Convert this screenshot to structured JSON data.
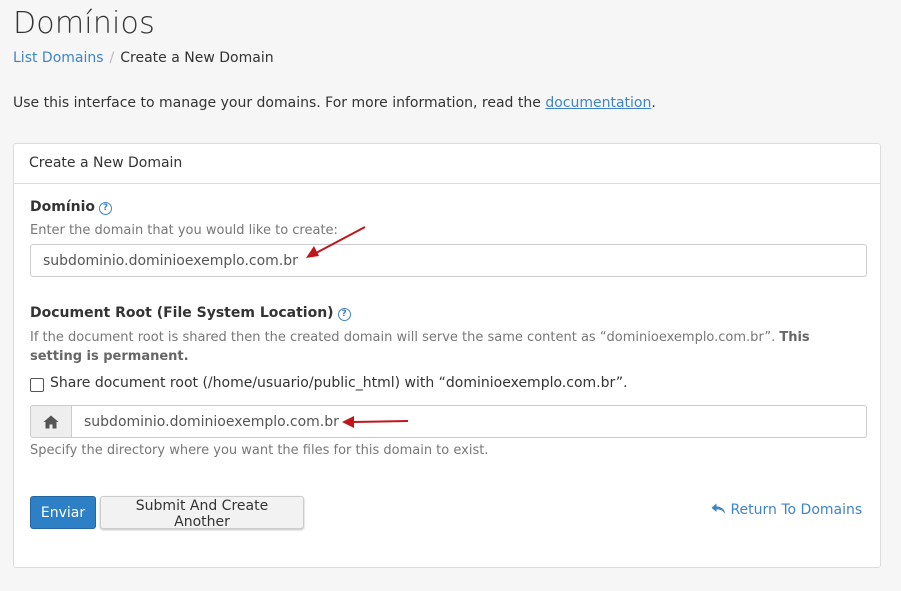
{
  "header": {
    "title": "Domínios"
  },
  "breadcrumb": {
    "link": "List Domains",
    "separator": "/",
    "current": "Create a New Domain"
  },
  "intro": {
    "text": "Use this interface to manage your domains. For more information, read the ",
    "link": "documentation",
    "suffix": "."
  },
  "panel": {
    "title": "Create a New Domain",
    "domain": {
      "label": "Domínio",
      "help": "?",
      "hint": "Enter the domain that you would like to create:",
      "value": "subdominio.dominioexemplo.com.br"
    },
    "docroot": {
      "label": "Document Root (File System Location)",
      "help": "?",
      "hint": "If the document root is shared then the created domain will serve the same content as “dominioexemplo.com.br”. ",
      "hint_bold": "This setting is permanent.",
      "share_label": "Share document root (/home/usuario/public_html) with “dominioexemplo.com.br”.",
      "share_checked": false,
      "value": "subdominio.dominioexemplo.com.br",
      "footer_hint": "Specify the directory where you want the files for this domain to exist."
    },
    "buttons": {
      "submit": "Enviar",
      "submit_another": "Submit And Create Another",
      "return": "Return To Domains"
    }
  },
  "colors": {
    "link": "#3f84c6",
    "primary": "#2d80c5",
    "annotation_arrow": "#c0161b"
  },
  "icons": {
    "help": "question-circle-icon",
    "home": "home-icon",
    "return": "reply-icon"
  }
}
